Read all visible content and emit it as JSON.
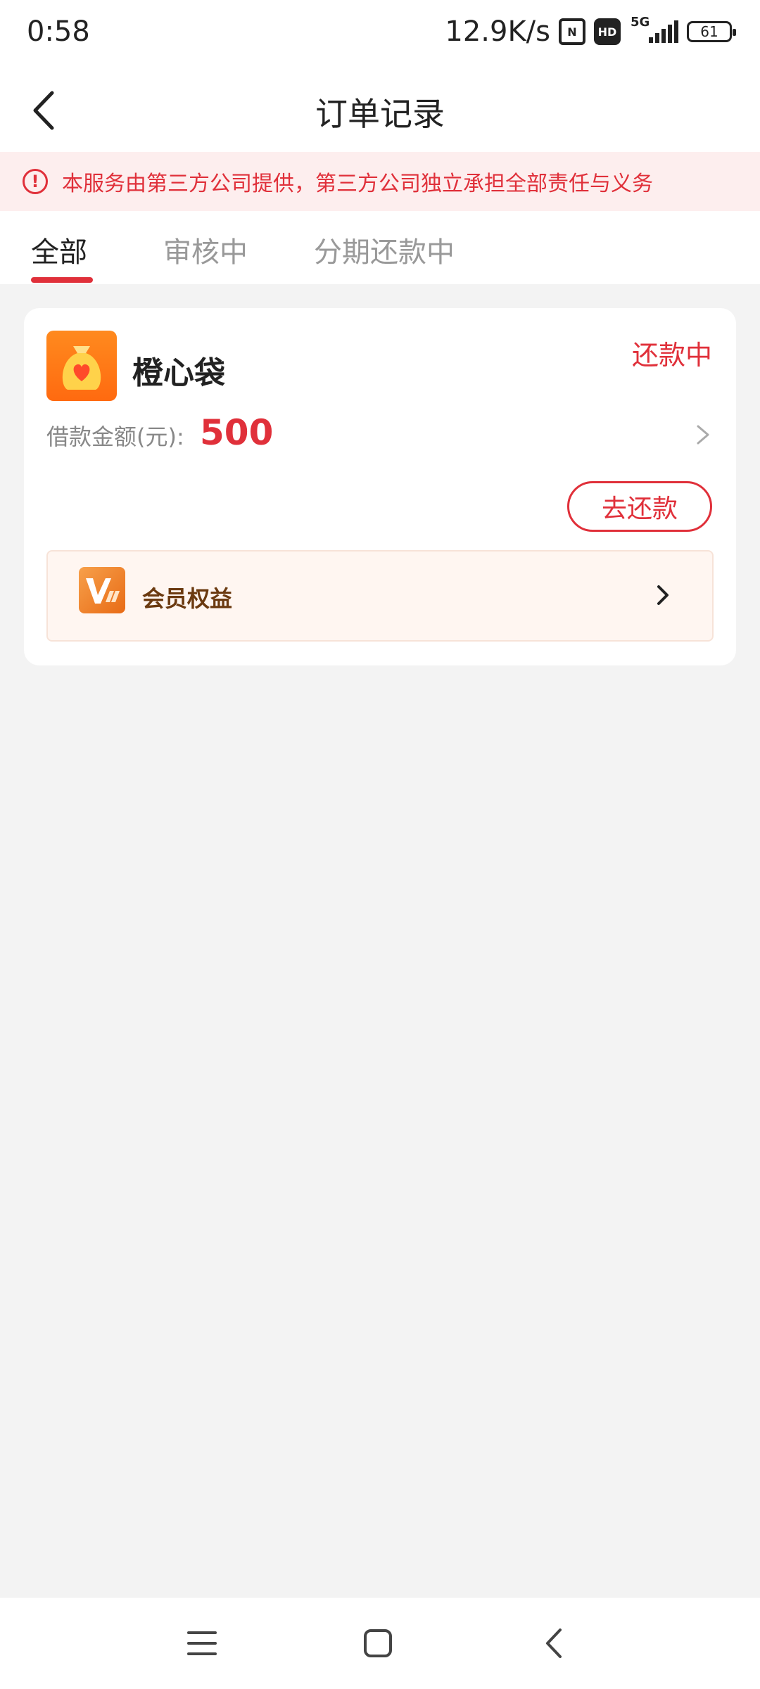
{
  "status_bar": {
    "time": "0:58",
    "speed": "12.9K/s",
    "nfc_icon": "N",
    "hd_icon": "HD",
    "network": "5G",
    "battery": "61"
  },
  "nav": {
    "title": "订单记录",
    "back_icon": "chevron-left-icon"
  },
  "notice": {
    "icon": "exclamation-circle-icon",
    "icon_glyph": "!",
    "text": "本服务由第三方公司提供，第三方公司独立承担全部责任与义务"
  },
  "tabs": [
    {
      "label": "全部",
      "active": true
    },
    {
      "label": "审核中",
      "active": false
    },
    {
      "label": "分期还款中",
      "active": false
    }
  ],
  "order_card": {
    "app_name": "橙心袋",
    "status": "还款中",
    "amount_label": "借款金额(元):",
    "amount_value": "500",
    "repay_button": "去还款",
    "vip": {
      "label": "会员权益",
      "icon": "vip-badge-icon"
    }
  },
  "colors": {
    "accent": "#e0303a",
    "brand_orange": "#ff7a18",
    "background": "#f3f3f3",
    "notice_bg": "#fdeeee"
  },
  "bottom_nav": {
    "menu_icon": "menu-icon",
    "home_icon": "home-square-icon",
    "back_icon": "back-icon"
  }
}
